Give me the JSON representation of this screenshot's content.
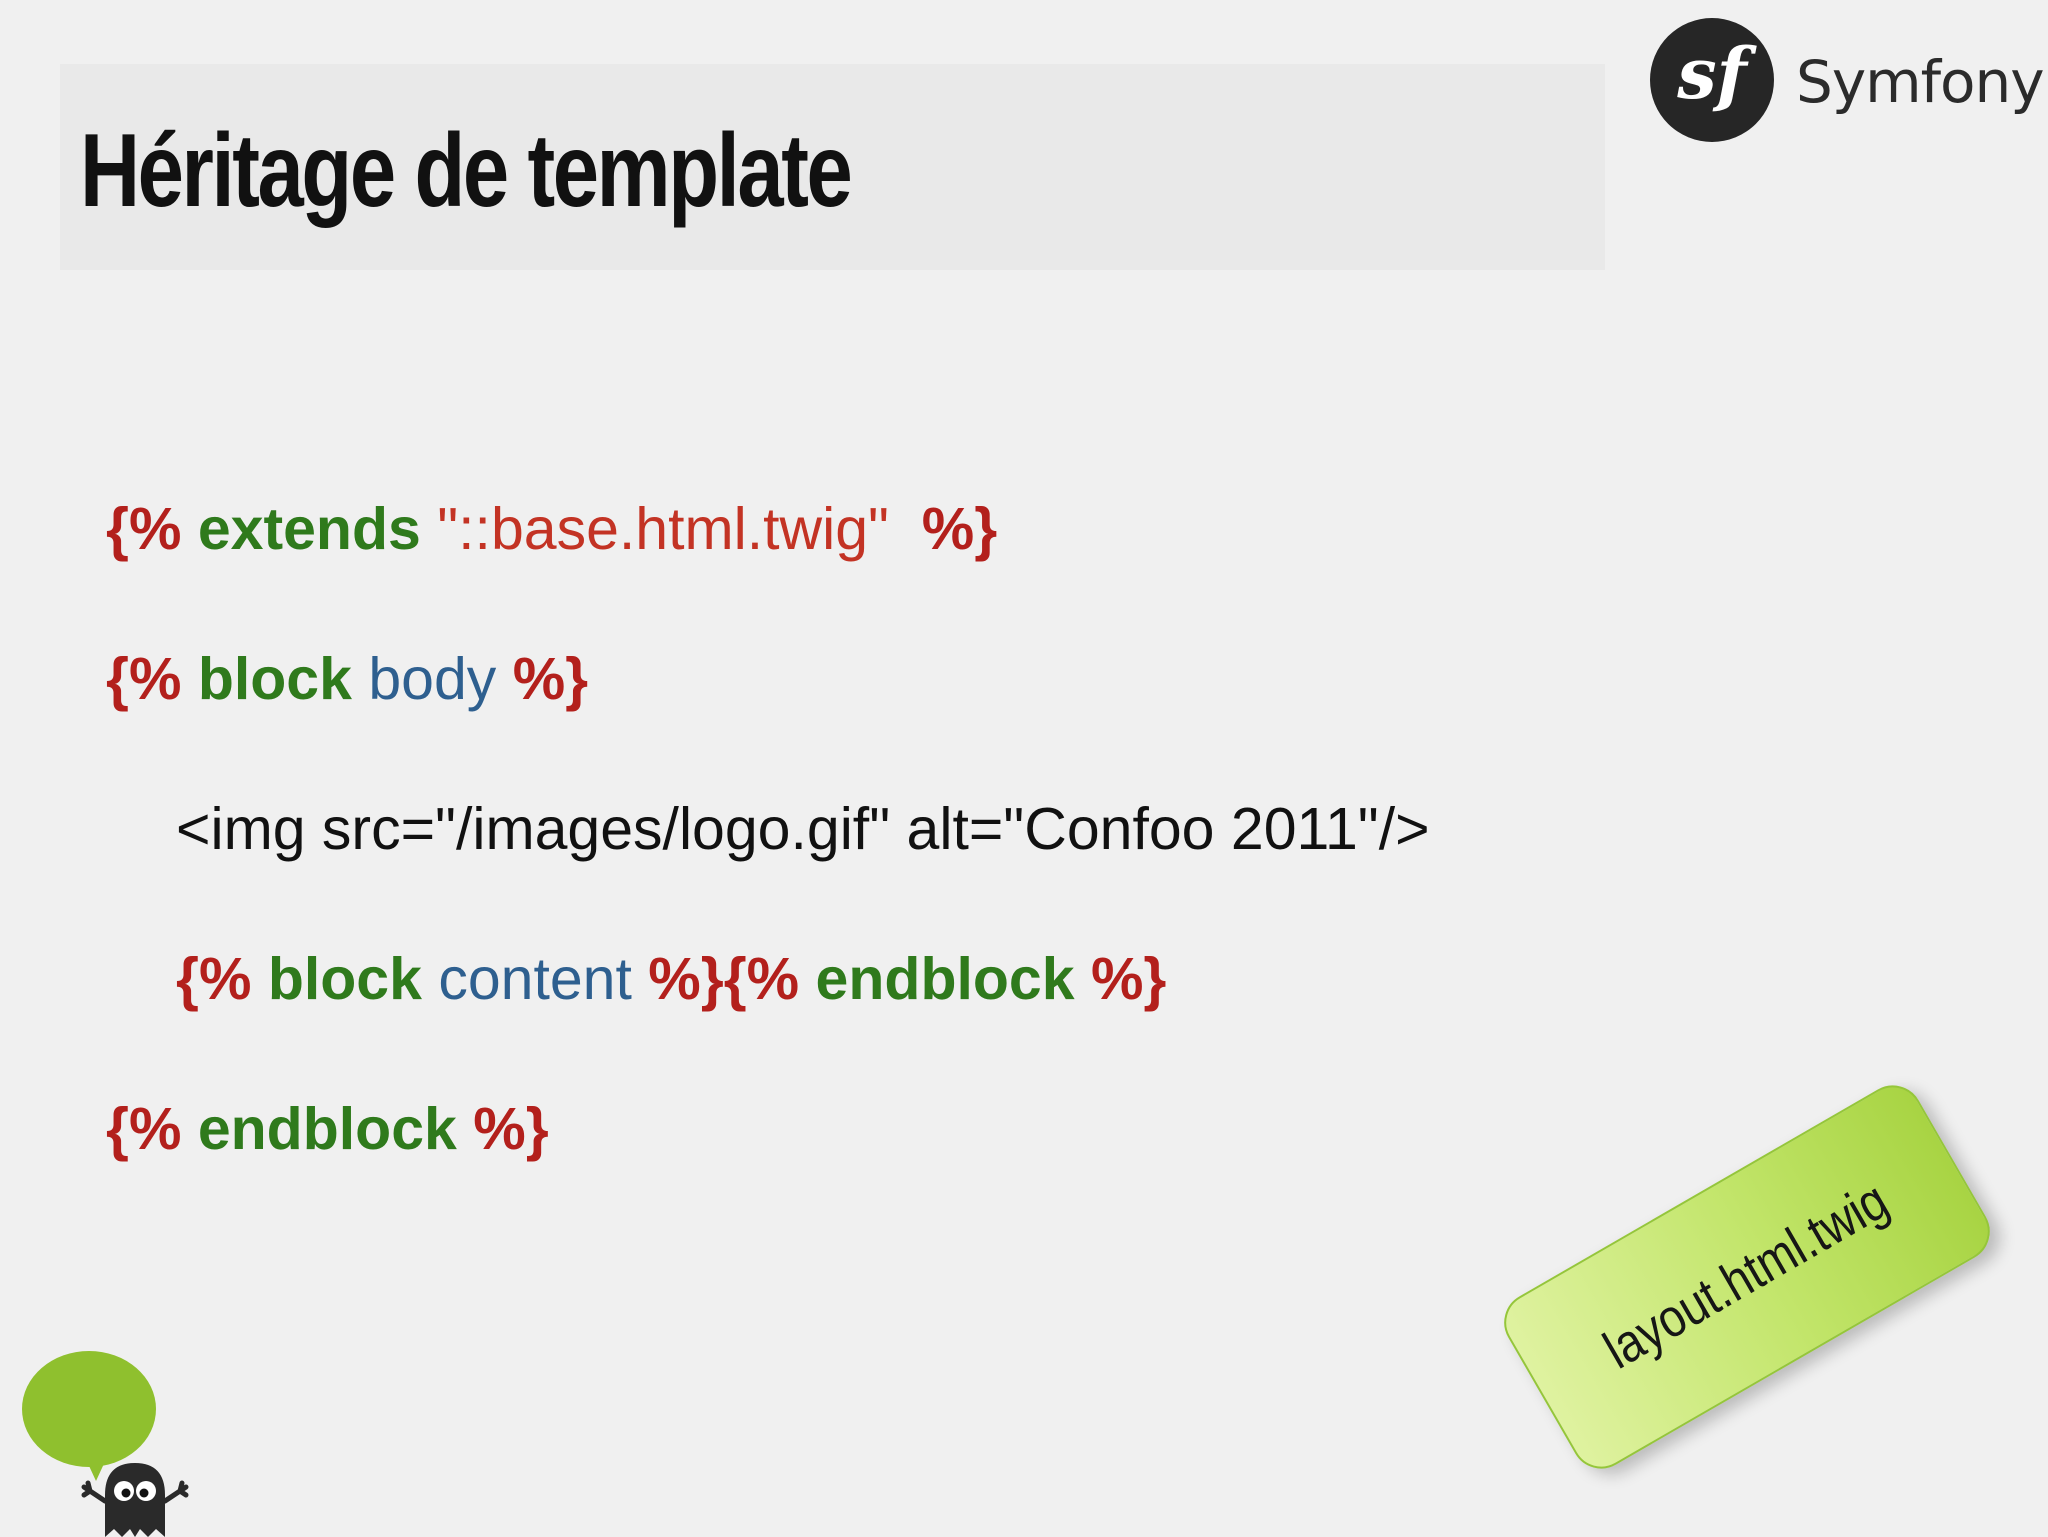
{
  "slide": {
    "title": "Héritage de template"
  },
  "brand": {
    "logo_text": "sf",
    "name": "Symfony"
  },
  "code": {
    "line1": {
      "open": "{%",
      "keyword": "extends",
      "string": "\"::base.html.twig\"",
      "close": "%}"
    },
    "line2": {
      "open": "{%",
      "keyword": "block",
      "name": "body",
      "close": "%}"
    },
    "line3": {
      "text": "<img src=\"/images/logo.gif\" alt=\"Confoo 2011\"/>"
    },
    "line4": {
      "open1": "{%",
      "keyword1": "block",
      "name": "content",
      "close1": "%}",
      "open2": "{%",
      "keyword2": "endblock",
      "close2": "%}"
    },
    "line5": {
      "open": "{%",
      "keyword": "endblock",
      "close": "%}"
    }
  },
  "file_tag": {
    "label": "layout.html.twig"
  },
  "colors": {
    "delimiter": "#b3201c",
    "keyword": "#2f7a1c",
    "string": "#c33324",
    "name": "#2e5f8f",
    "tag_green": "#b5dc55",
    "mascot_green": "#8fc02e"
  }
}
